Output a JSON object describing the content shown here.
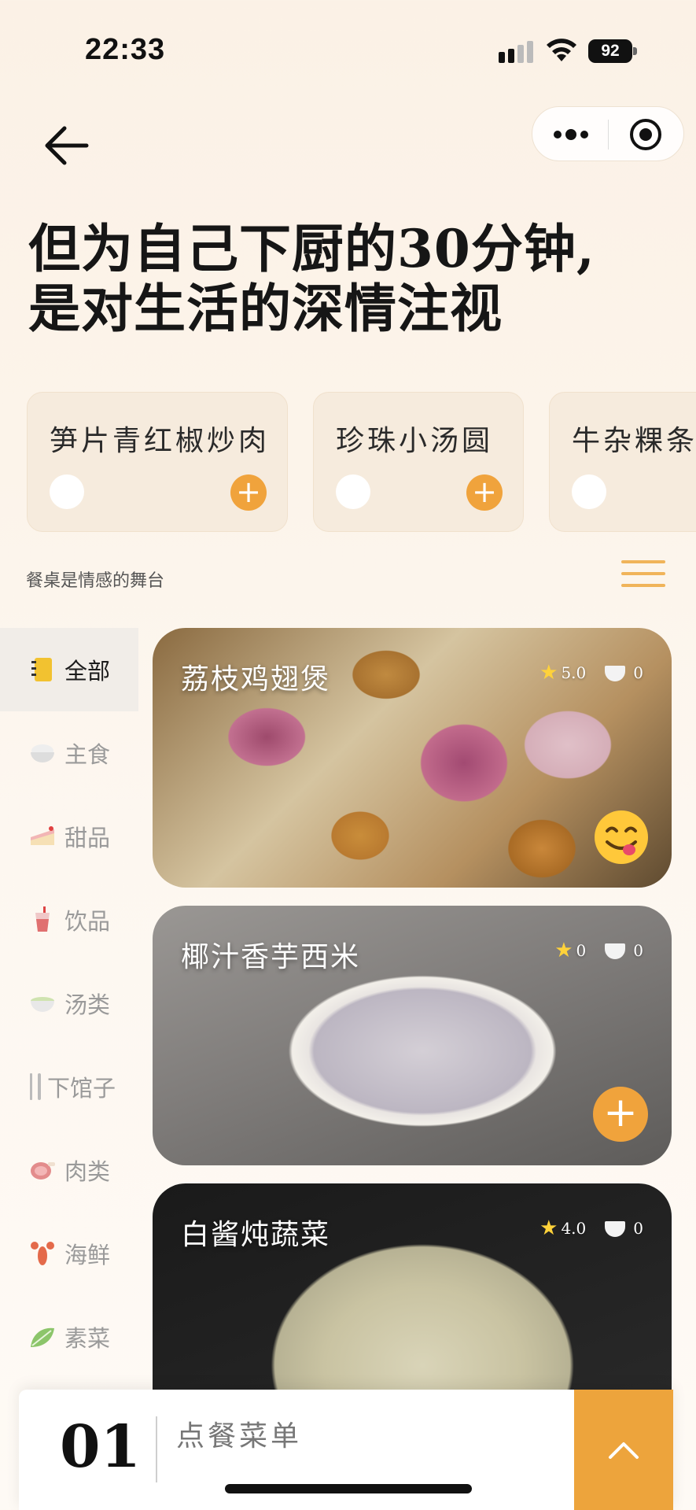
{
  "status": {
    "time": "22:33",
    "battery": "92"
  },
  "headline": {
    "line1": "但为自己下厨的30分钟,",
    "line2": "是对生活的深情注视"
  },
  "recommend": [
    {
      "name": "笋片青红椒炒肉"
    },
    {
      "name": "珍珠小汤圆"
    },
    {
      "name": "牛杂粿条"
    }
  ],
  "subtitle": "餐桌是情感的舞台",
  "categories": [
    {
      "label": "全部",
      "icon": "notebook-icon",
      "active": true
    },
    {
      "label": "主食",
      "icon": "rice-bowl-icon"
    },
    {
      "label": "甜品",
      "icon": "cake-icon"
    },
    {
      "label": "饮品",
      "icon": "drink-icon"
    },
    {
      "label": "汤类",
      "icon": "soup-icon"
    },
    {
      "label": "下馆子",
      "icon": "fork-knife-icon"
    },
    {
      "label": "肉类",
      "icon": "meat-icon"
    },
    {
      "label": "海鲜",
      "icon": "lobster-icon"
    },
    {
      "label": "素菜",
      "icon": "leafy-green-icon"
    }
  ],
  "dishes": [
    {
      "title": "荔枝鸡翅煲",
      "rating": "5.0",
      "ordered": "0",
      "ordered_state": "yummy-face-icon"
    },
    {
      "title": "椰汁香芋西米",
      "rating": "0",
      "ordered": "0"
    },
    {
      "title": "白酱炖蔬菜",
      "rating": "4.0",
      "ordered": "0"
    }
  ],
  "bottom": {
    "count": "01",
    "label": "点餐菜单"
  },
  "colors": {
    "accent": "#eda43c",
    "card_bg": "#f6ebdd",
    "star": "#ffd23a"
  }
}
